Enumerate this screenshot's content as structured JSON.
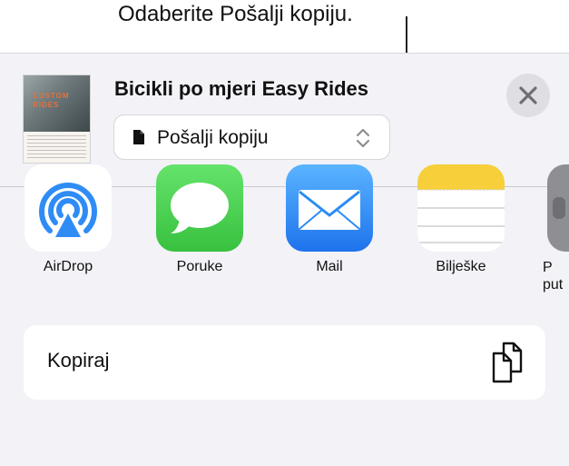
{
  "callout": {
    "text": "Odaberite Pošalji kopiju."
  },
  "header": {
    "doc_title": "Bicikli po mjeri Easy Rides",
    "thumbnail_words": [
      "CUSTOM",
      "RIDES"
    ],
    "format_select": {
      "value": "Pošalji kopiju",
      "icon": "doc-icon"
    },
    "close_icon": "close-icon"
  },
  "apps": [
    {
      "label": "AirDrop",
      "icon": "airdrop-icon"
    },
    {
      "label": "Poruke",
      "icon": "messages-icon"
    },
    {
      "label": "Mail",
      "icon": "mail-icon"
    },
    {
      "label": "Bilješke",
      "icon": "notes-icon"
    },
    {
      "label": "P\nput",
      "icon": "more-app-icon"
    }
  ],
  "actions": [
    {
      "label": "Kopiraj",
      "icon": "copy-icon"
    }
  ],
  "colors": {
    "airdrop_blue": "#2f8cf5",
    "messages_green": "#4fcd53",
    "mail_blue": "#2b8cf3",
    "notes_yellow": "#f6cf3a",
    "sheet_bg": "#f2f2f7"
  }
}
